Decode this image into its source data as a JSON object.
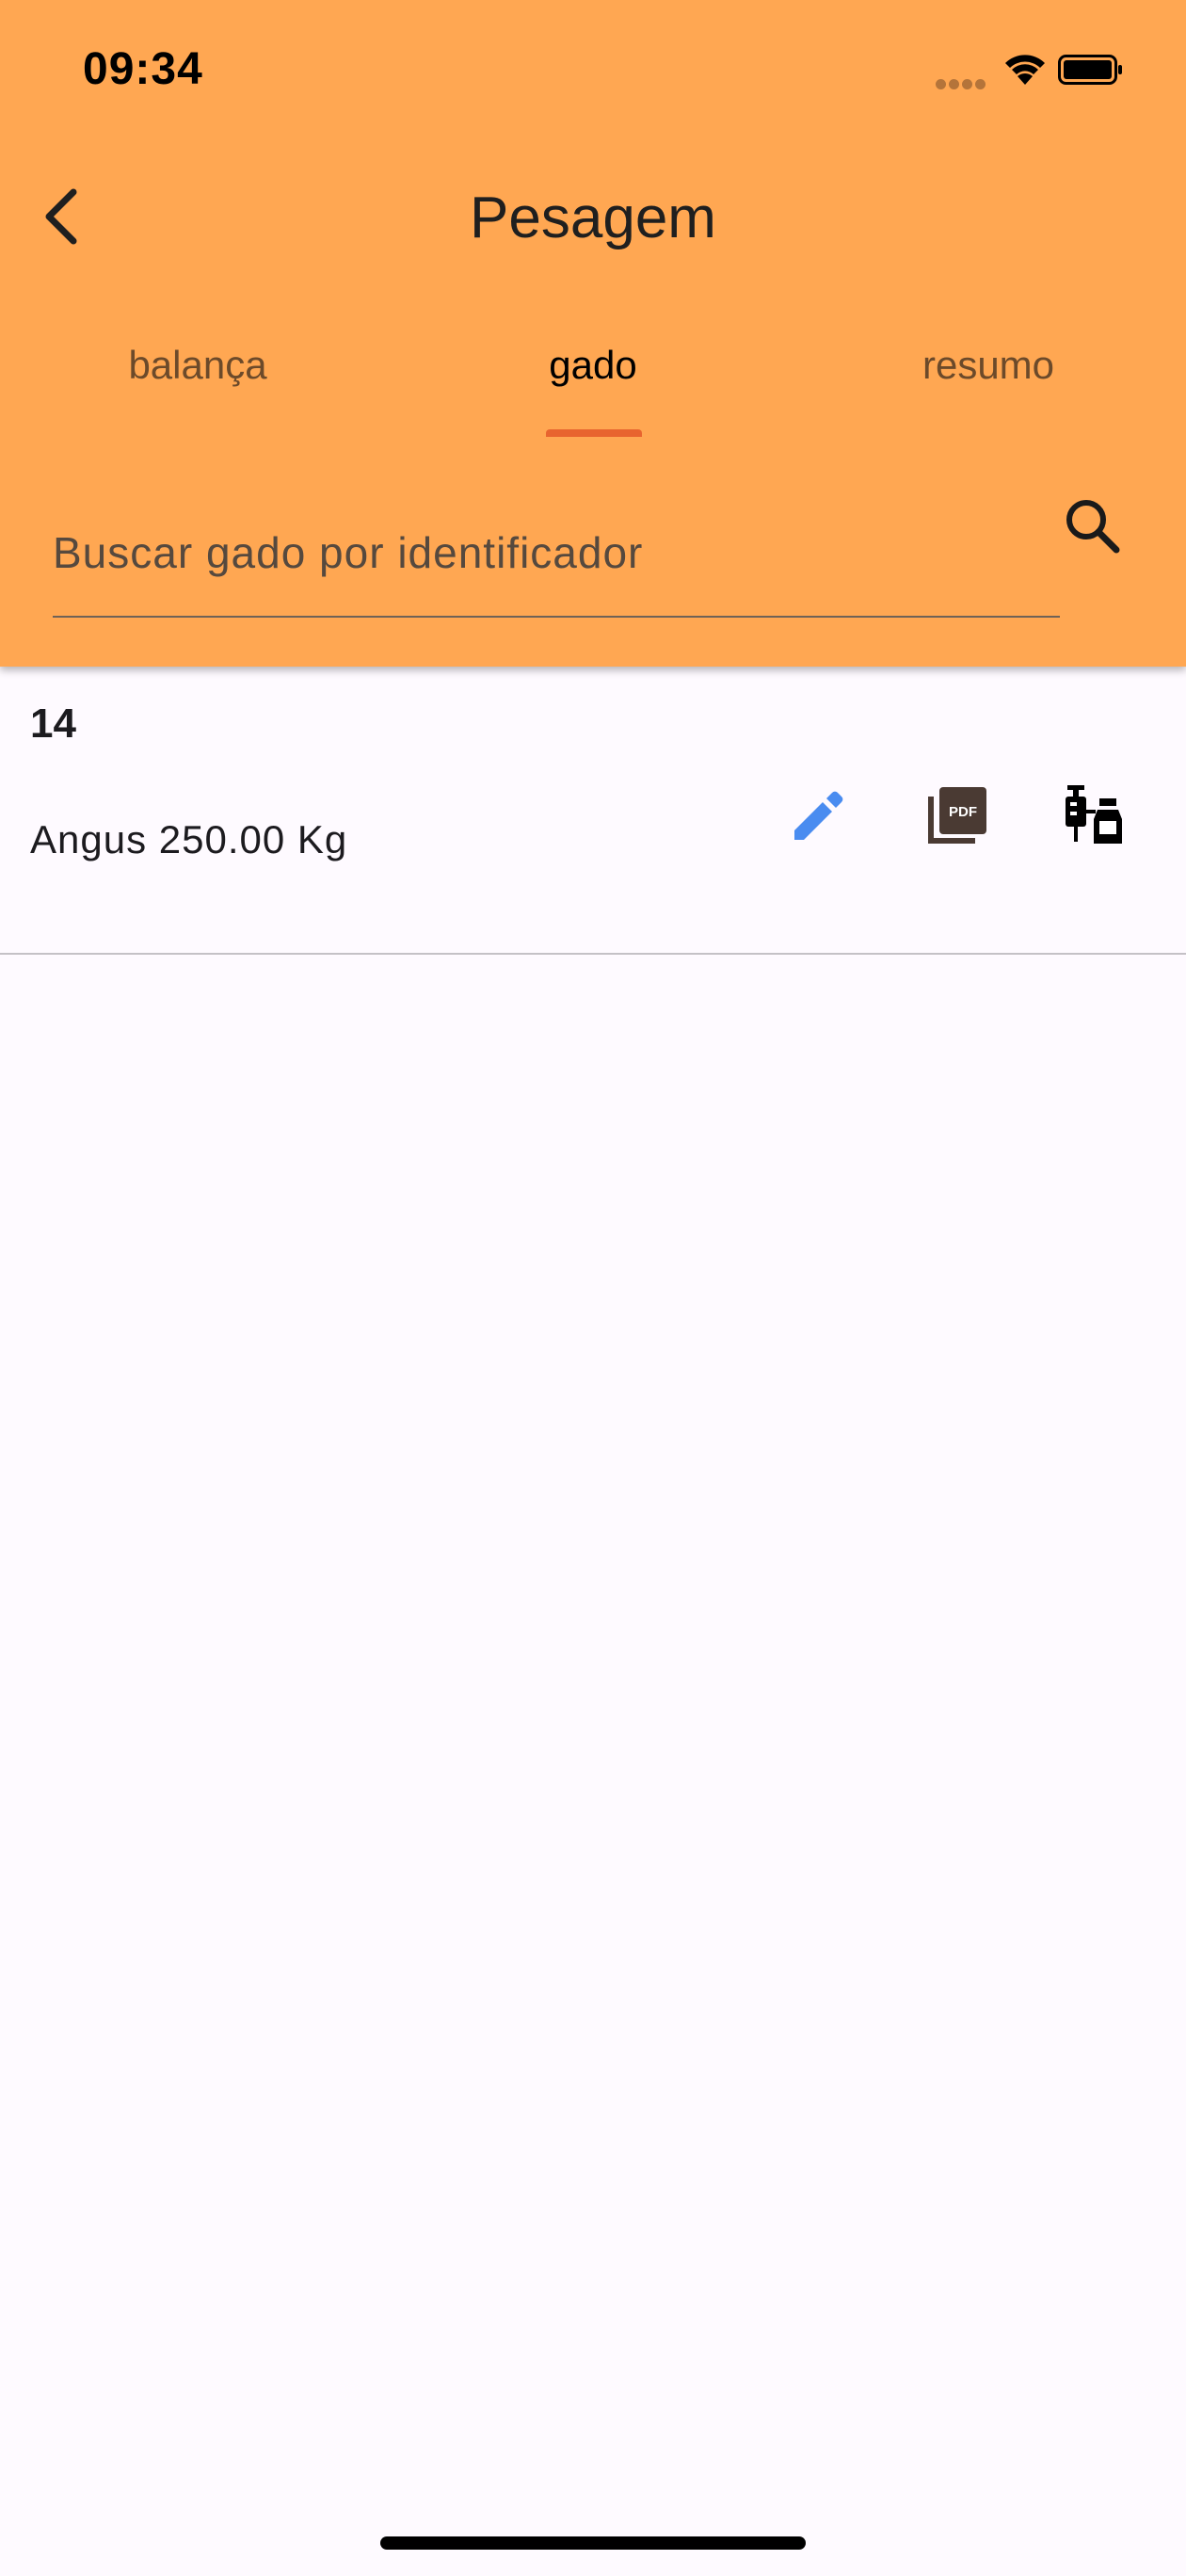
{
  "status_bar": {
    "time": "09:34"
  },
  "app_bar": {
    "title": "Pesagem"
  },
  "tabs": [
    {
      "label": "balança",
      "active": false
    },
    {
      "label": "gado",
      "active": true
    },
    {
      "label": "resumo",
      "active": false
    }
  ],
  "search": {
    "placeholder": "Buscar gado por identificador",
    "value": ""
  },
  "list": [
    {
      "id": "14",
      "subtitle": "Angus 250.00 Kg",
      "actions": [
        "edit-icon",
        "picture-as-pdf-icon",
        "vaccines-icon"
      ]
    }
  ],
  "colors": {
    "app_bar": "#ffa752",
    "tab_indicator": "#e8642f",
    "edit_icon": "#4a8cf0",
    "background": "#fefaff"
  }
}
